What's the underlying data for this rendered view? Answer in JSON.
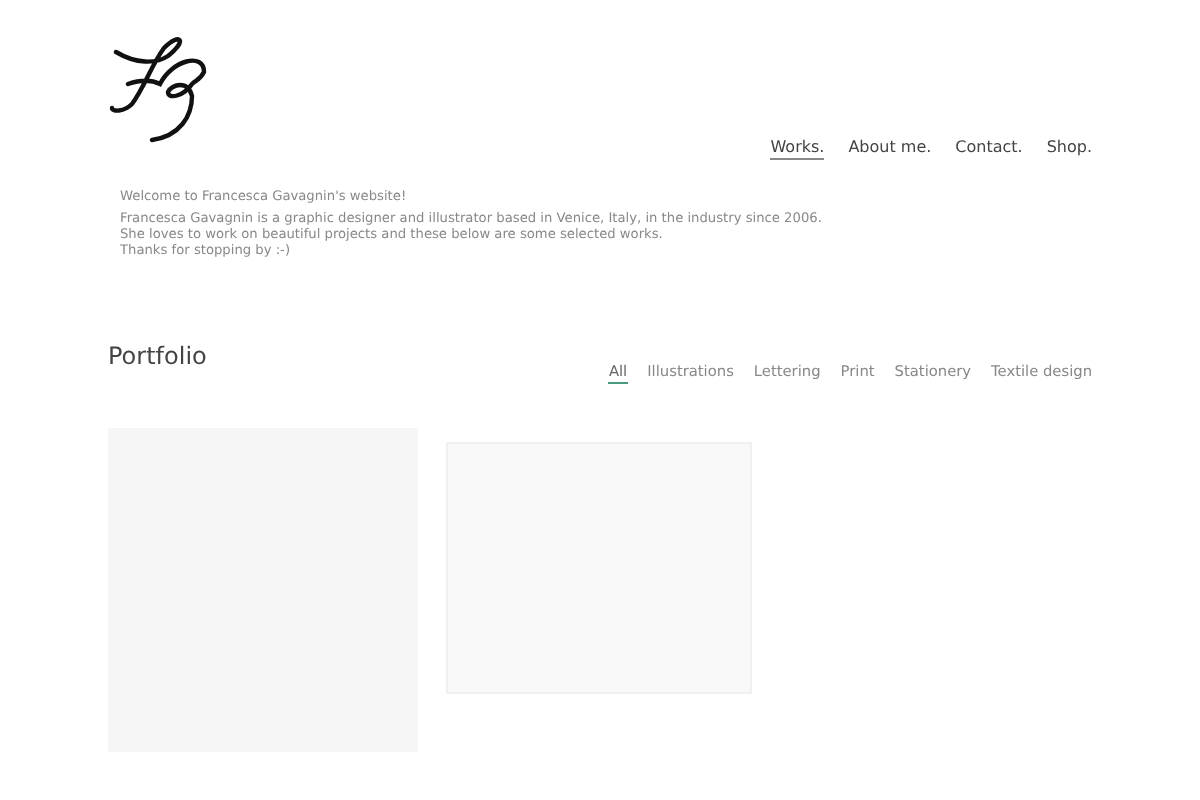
{
  "nav": [
    {
      "label": "Works.",
      "selected": true
    },
    {
      "label": "About me.",
      "selected": false
    },
    {
      "label": "Contact.",
      "selected": false
    },
    {
      "label": "Shop.",
      "selected": false
    }
  ],
  "intro": {
    "heading": "Welcome to Francesca Gavagnin's website!",
    "lines": [
      "Francesca Gavagnin is a graphic designer and illustrator based in Venice, Italy, in the industry since 2006.",
      "She loves to work on beautiful projects and these below are some selected works.",
      "Thanks for stopping by :-)"
    ]
  },
  "portfolio": {
    "title": "Portfolio",
    "filters": [
      {
        "label": "All",
        "selected": true
      },
      {
        "label": "Illustrations",
        "selected": false
      },
      {
        "label": "Lettering",
        "selected": false
      },
      {
        "label": "Print",
        "selected": false
      },
      {
        "label": "Stationery",
        "selected": false
      },
      {
        "label": "Textile design",
        "selected": false
      }
    ],
    "items": [
      {
        "kind": "loading"
      },
      {
        "kind": "faint"
      }
    ]
  }
}
